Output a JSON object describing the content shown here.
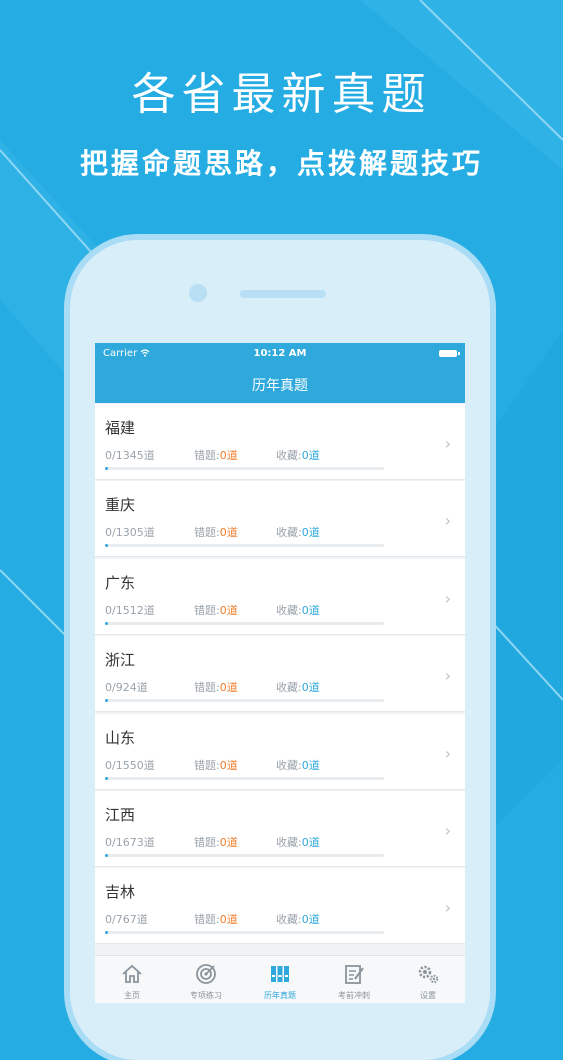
{
  "promo": {
    "title": "各省最新真题",
    "subtitle": "把握命题思路，点拨解题技巧"
  },
  "status_bar": {
    "carrier": "Carrier",
    "time": "10:12 AM"
  },
  "nav": {
    "title": "历年真题"
  },
  "labels": {
    "wrong": "错题:",
    "fav": "收藏:"
  },
  "provinces": [
    {
      "name": "福建",
      "count": "0/1345道",
      "wrong": "0道",
      "fav": "0道",
      "progress": 0.01
    },
    {
      "name": "重庆",
      "count": "0/1305道",
      "wrong": "0道",
      "fav": "0道",
      "progress": 0.01
    },
    {
      "name": "广东",
      "count": "0/1512道",
      "wrong": "0道",
      "fav": "0道",
      "progress": 0.01
    },
    {
      "name": "浙江",
      "count": "0/924道",
      "wrong": "0道",
      "fav": "0道",
      "progress": 0.01
    },
    {
      "name": "山东",
      "count": "0/1550道",
      "wrong": "0道",
      "fav": "0道",
      "progress": 0.01
    },
    {
      "name": "江西",
      "count": "0/1673道",
      "wrong": "0道",
      "fav": "0道",
      "progress": 0.01
    },
    {
      "name": "吉林",
      "count": "0/767道",
      "wrong": "0道",
      "fav": "0道",
      "progress": 0.01
    }
  ],
  "tabs": [
    {
      "label": "主页",
      "icon": "home-icon",
      "active": false
    },
    {
      "label": "专项练习",
      "icon": "target-icon",
      "active": false
    },
    {
      "label": "历年真题",
      "icon": "binders-icon",
      "active": true
    },
    {
      "label": "考前冲刺",
      "icon": "edit-doc-icon",
      "active": false
    },
    {
      "label": "设置",
      "icon": "gears-icon",
      "active": false
    }
  ],
  "colors": {
    "brand": "#2fa8dc",
    "background": "#24ace3",
    "accent_orange": "#f07c2a"
  }
}
